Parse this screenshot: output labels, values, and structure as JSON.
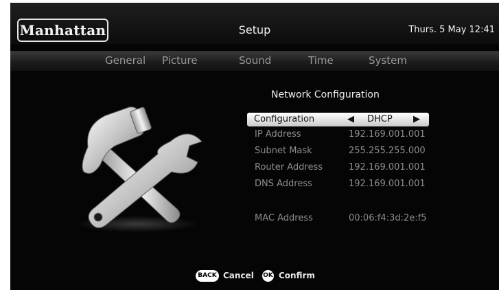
{
  "header": {
    "logo": "Manhattan",
    "title": "Setup",
    "datetime": "Thurs. 5 May  12:41"
  },
  "tabs": [
    {
      "label": "General"
    },
    {
      "label": "Picture"
    },
    {
      "label": "Sound"
    },
    {
      "label": "Time"
    },
    {
      "label": "System"
    }
  ],
  "icon": "hammer-and-wrench-icon",
  "panel": {
    "title": "Network Configuration",
    "configuration": {
      "label": "Configuration",
      "value": "DHCP",
      "left_arrow": "◀",
      "right_arrow": "▶"
    },
    "rows": [
      {
        "label": "IP Address",
        "value": "192.169.001.001"
      },
      {
        "label": "Subnet Mask",
        "value": "255.255.255.000"
      },
      {
        "label": "Router Address",
        "value": "192.169.001.001"
      },
      {
        "label": "DNS Address",
        "value": "192.169.001.001"
      }
    ],
    "mac": {
      "label": "MAC Address",
      "value": "00:06:f4:3d:2e:f5"
    }
  },
  "footer": {
    "back_key": "BACK",
    "back_label": "Cancel",
    "ok_key": "OK",
    "ok_label": "Confirm"
  }
}
